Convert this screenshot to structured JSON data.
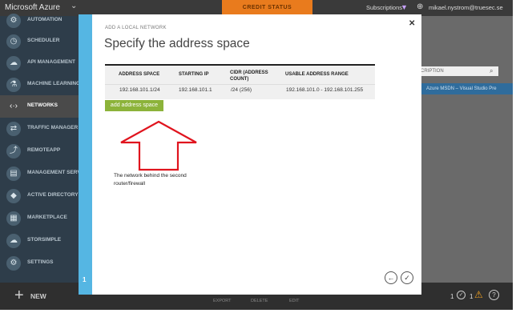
{
  "topbar": {
    "brand": "Microsoft Azure",
    "credit_status": "CREDIT STATUS",
    "subscriptions": "Subscriptions",
    "user": "mikael.nystrom@truesec.se"
  },
  "sidebar": {
    "items": [
      {
        "label": "AUTOMATION",
        "icon": "gear-icon"
      },
      {
        "label": "SCHEDULER",
        "icon": "clock-icon"
      },
      {
        "label": "API MANAGEMENT",
        "icon": "cloud-gear-icon"
      },
      {
        "label": "MACHINE LEARNING",
        "icon": "flask-icon"
      },
      {
        "label": "NETWORKS",
        "icon": "network-icon",
        "active": true
      },
      {
        "label": "TRAFFIC MANAGER",
        "icon": "traffic-icon"
      },
      {
        "label": "REMOTEAPP",
        "icon": "remoteapp-icon"
      },
      {
        "label": "MANAGEMENT SERVI",
        "icon": "management-icon"
      },
      {
        "label": "ACTIVE DIRECTORY",
        "icon": "directory-icon"
      },
      {
        "label": "MARKETPLACE",
        "icon": "marketplace-icon"
      },
      {
        "label": "STORSIMPLE",
        "icon": "storsimple-icon"
      },
      {
        "label": "SETTINGS",
        "icon": "settings-gear-icon"
      }
    ]
  },
  "background": {
    "search_placeholder": "SCRIPTION",
    "row_text": "Azure MSDN – Visual Studio Pre"
  },
  "dialog": {
    "subtitle": "ADD A LOCAL NETWORK",
    "title": "Specify the address space",
    "step": "1",
    "table": {
      "headers": [
        "ADDRESS SPACE",
        "STARTING IP",
        "CIDR (ADDRESS COUNT)",
        "USABLE ADDRESS RANGE"
      ],
      "rows": [
        [
          "192.168.101.1/24",
          "192.168.101.1",
          "/24 (256)",
          "192.168.101.0 - 192.168.101.255"
        ]
      ]
    },
    "add_button": "add address space",
    "annotation": {
      "line1": "The network behind the second",
      "line2": "router/firewall",
      "arrow_color": "#e0141e"
    }
  },
  "bottombar": {
    "new_label": "NEW",
    "actions": [
      "EXPORT",
      "DELETE",
      "EDIT"
    ],
    "running_count": "1",
    "warning_count": "1"
  },
  "colors": {
    "step_rail": "#55b6e3",
    "add_button": "#8cb33a",
    "sidebar": "#2e3d4a",
    "credit": "#e97b1d"
  }
}
